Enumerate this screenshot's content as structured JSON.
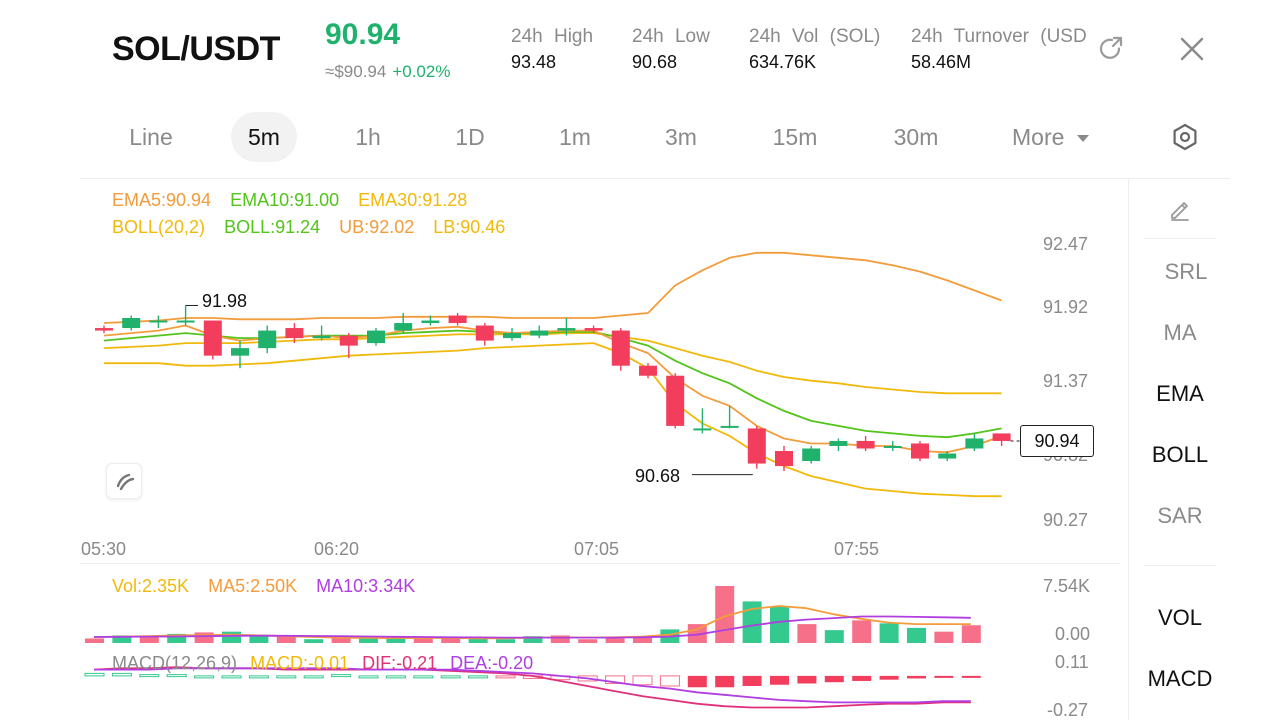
{
  "header": {
    "pair": "SOL/USDT",
    "price": "90.94",
    "approx": "≈$90.94",
    "change": "+0.02%",
    "stats": [
      {
        "label": "24h  High",
        "value": "93.48"
      },
      {
        "label": "24h  Low",
        "value": "90.68"
      },
      {
        "label": "24h  Vol (SOL)",
        "value": "634.76K"
      },
      {
        "label": "24h  Turnover (USD",
        "value": "58.46M"
      }
    ],
    "icons": [
      "share-icon",
      "close-icon"
    ]
  },
  "tabs": [
    {
      "label": "Line"
    },
    {
      "label": "5m",
      "active": true
    },
    {
      "label": "1h"
    },
    {
      "label": "1D"
    },
    {
      "label": "1m"
    },
    {
      "label": "3m"
    },
    {
      "label": "15m"
    },
    {
      "label": "30m"
    },
    {
      "label": "More"
    }
  ],
  "indicators": {
    "ema": {
      "ema5": "EMA5:90.94",
      "ema10": "EMA10:91.00",
      "ema30": "EMA30:91.28"
    },
    "boll": {
      "name": "BOLL(20,2)",
      "mid": "BOLL:91.24",
      "ub": "UB:92.02",
      "lb": "LB:90.46"
    },
    "vol": {
      "vol": "Vol:2.35K",
      "ma5": "MA5:2.50K",
      "ma10": "MA10:3.34K"
    },
    "macd": {
      "name": "MACD(12,26,9)",
      "macd": "MACD:-0.01",
      "dif": "DIF:-0.21",
      "dea": "DEA:-0.20"
    }
  },
  "side_panel": {
    "tools": [
      "SRL",
      "MA",
      "EMA",
      "BOLL",
      "SAR"
    ],
    "active": [
      "EMA",
      "BOLL"
    ],
    "sub": [
      "VOL",
      "MACD"
    ]
  },
  "colors": {
    "up": "#20b26c",
    "down": "#f23d5c",
    "ema5": "#f5a623",
    "ema10": "#52c41a",
    "ema30": "#f0b90b"
  },
  "chart_data": {
    "type": "candlestick",
    "x_ticks": [
      "05:30",
      "06:20",
      "07:05",
      "07:55"
    ],
    "y_ticks": [
      "92.47",
      "91.92",
      "91.37",
      "90.82",
      "90.27"
    ],
    "vol_ticks": [
      "7.54K",
      "0.00"
    ],
    "macd_ticks": [
      "0.11",
      "-0.27"
    ],
    "current_price": "90.94",
    "high_label": "91.98",
    "low_label": "90.68",
    "candles": [
      [
        91.8,
        91.78,
        91.82,
        91.76
      ],
      [
        91.8,
        91.88,
        91.9,
        91.78
      ],
      [
        91.86,
        91.86,
        91.9,
        91.8
      ],
      [
        91.86,
        91.86,
        91.98,
        91.82
      ],
      [
        91.86,
        91.58,
        91.86,
        91.55
      ],
      [
        91.58,
        91.64,
        91.7,
        91.48
      ],
      [
        91.64,
        91.78,
        91.82,
        91.6
      ],
      [
        91.8,
        91.72,
        91.84,
        91.68
      ],
      [
        91.72,
        91.74,
        91.82,
        91.7
      ],
      [
        91.74,
        91.66,
        91.76,
        91.56
      ],
      [
        91.68,
        91.78,
        91.8,
        91.66
      ],
      [
        91.78,
        91.84,
        91.92,
        91.76
      ],
      [
        91.84,
        91.86,
        91.9,
        91.82
      ],
      [
        91.9,
        91.84,
        91.92,
        91.82
      ],
      [
        91.82,
        91.7,
        91.84,
        91.66
      ],
      [
        91.72,
        91.76,
        91.8,
        91.7
      ],
      [
        91.74,
        91.78,
        91.82,
        91.72
      ],
      [
        91.78,
        91.8,
        91.88,
        91.74
      ],
      [
        91.8,
        91.78,
        91.82,
        91.76
      ],
      [
        91.78,
        91.5,
        91.8,
        91.46
      ],
      [
        91.5,
        91.42,
        91.52,
        91.4
      ],
      [
        91.42,
        91.02,
        91.44,
        91.0
      ],
      [
        91.0,
        91.0,
        91.16,
        90.96
      ],
      [
        91.02,
        91.02,
        91.18,
        91.0
      ],
      [
        91.0,
        90.72,
        91.02,
        90.68
      ],
      [
        90.82,
        90.7,
        90.86,
        90.66
      ],
      [
        90.74,
        90.84,
        90.86,
        90.72
      ],
      [
        90.86,
        90.9,
        90.92,
        90.82
      ],
      [
        90.9,
        90.84,
        90.94,
        90.82
      ],
      [
        90.86,
        90.86,
        90.9,
        90.82
      ],
      [
        90.88,
        90.76,
        90.9,
        90.74
      ],
      [
        90.76,
        90.8,
        90.82,
        90.74
      ],
      [
        90.84,
        90.92,
        90.96,
        90.82
      ],
      [
        90.96,
        90.9,
        90.96,
        90.86
      ]
    ],
    "ema5_series": [
      91.74,
      91.76,
      91.78,
      91.82,
      91.74,
      91.7,
      91.72,
      91.73,
      91.74,
      91.72,
      91.74,
      91.78,
      91.8,
      91.81,
      91.78,
      91.76,
      91.77,
      91.78,
      91.78,
      91.68,
      91.6,
      91.4,
      91.26,
      91.18,
      91.02,
      90.92,
      90.88,
      90.88,
      90.86,
      90.86,
      90.82,
      90.81,
      90.86,
      90.94
    ],
    "ema10_series": [
      91.7,
      91.72,
      91.74,
      91.76,
      91.74,
      91.72,
      91.72,
      91.73,
      91.74,
      91.74,
      91.74,
      91.76,
      91.77,
      91.78,
      91.77,
      91.76,
      91.76,
      91.77,
      91.77,
      91.72,
      91.66,
      91.54,
      91.44,
      91.36,
      91.24,
      91.14,
      91.06,
      91.02,
      90.98,
      90.96,
      90.94,
      90.93,
      90.96,
      91.0
    ],
    "ema30_series": [
      91.64,
      91.65,
      91.66,
      91.68,
      91.68,
      91.68,
      91.69,
      91.7,
      91.71,
      91.71,
      91.72,
      91.73,
      91.74,
      91.75,
      91.75,
      91.75,
      91.75,
      91.76,
      91.76,
      91.73,
      91.7,
      91.64,
      91.58,
      91.53,
      91.46,
      91.41,
      91.38,
      91.36,
      91.33,
      91.31,
      91.29,
      91.28,
      91.28,
      91.28
    ],
    "boll_ub": [
      91.84,
      91.85,
      91.86,
      91.88,
      91.88,
      91.87,
      91.87,
      91.87,
      91.88,
      91.88,
      91.88,
      91.89,
      91.89,
      91.89,
      91.89,
      91.88,
      91.88,
      91.88,
      91.88,
      91.9,
      91.92,
      92.14,
      92.26,
      92.36,
      92.4,
      92.4,
      92.38,
      92.36,
      92.34,
      92.3,
      92.25,
      92.18,
      92.1,
      92.02
    ],
    "boll_lb": [
      91.52,
      91.52,
      91.52,
      91.5,
      91.5,
      91.51,
      91.52,
      91.54,
      91.56,
      91.58,
      91.59,
      91.6,
      91.61,
      91.62,
      91.64,
      91.65,
      91.66,
      91.67,
      91.68,
      91.6,
      91.48,
      91.2,
      91.04,
      90.94,
      90.8,
      90.7,
      90.62,
      90.57,
      90.52,
      90.5,
      90.48,
      90.47,
      90.46,
      90.46
    ],
    "volume": [
      0.6,
      1.0,
      0.8,
      1.2,
      1.4,
      1.5,
      1.1,
      1.0,
      0.5,
      0.8,
      0.6,
      0.7,
      0.6,
      0.7,
      0.6,
      0.5,
      0.9,
      1.0,
      0.5,
      0.6,
      0.8,
      1.8,
      2.5,
      7.54,
      5.5,
      4.8,
      2.5,
      1.7,
      3.0,
      2.6,
      2.0,
      1.5,
      2.35
    ],
    "volume_dir": [
      "d",
      "u",
      "d",
      "u",
      "d",
      "u",
      "u",
      "d",
      "u",
      "d",
      "u",
      "u",
      "d",
      "d",
      "u",
      "u",
      "u",
      "d",
      "d",
      "d",
      "d",
      "u",
      "d",
      "d",
      "u",
      "u",
      "d",
      "u",
      "d",
      "u",
      "u",
      "d"
    ],
    "vol_ma5": [
      0.8,
      0.85,
      0.9,
      1.0,
      1.05,
      1.1,
      1.0,
      0.9,
      0.8,
      0.7,
      0.68,
      0.65,
      0.66,
      0.66,
      0.62,
      0.62,
      0.7,
      0.75,
      0.72,
      0.75,
      0.85,
      1.1,
      1.8,
      3.5,
      4.5,
      4.9,
      4.6,
      3.8,
      3.2,
      2.7,
      2.5,
      2.5,
      2.5
    ],
    "vol_ma10": [
      0.8,
      0.82,
      0.84,
      0.86,
      0.9,
      0.95,
      0.96,
      0.95,
      0.93,
      0.9,
      0.86,
      0.82,
      0.8,
      0.76,
      0.74,
      0.72,
      0.72,
      0.72,
      0.72,
      0.72,
      0.75,
      0.85,
      1.1,
      1.7,
      2.3,
      2.8,
      3.1,
      3.3,
      3.5,
      3.5,
      3.45,
      3.4,
      3.34
    ],
    "macd_hist": [
      0.02,
      0.02,
      0.01,
      0.01,
      0.0,
      0.0,
      0.0,
      0.0,
      0.0,
      0.01,
      0.0,
      0.0,
      0.0,
      0.0,
      0.0,
      -0.01,
      -0.02,
      -0.03,
      -0.04,
      -0.06,
      -0.07,
      -0.08,
      -0.09,
      -0.09,
      -0.08,
      -0.07,
      -0.06,
      -0.05,
      -0.04,
      -0.03,
      -0.02,
      -0.01,
      -0.01
    ],
    "macd_dif": [
      0.05,
      0.06,
      0.06,
      0.07,
      0.06,
      0.06,
      0.06,
      0.05,
      0.05,
      0.05,
      0.05,
      0.05,
      0.05,
      0.04,
      0.03,
      0.02,
      0.0,
      -0.04,
      -0.08,
      -0.12,
      -0.16,
      -0.19,
      -0.22,
      -0.24,
      -0.25,
      -0.25,
      -0.25,
      -0.24,
      -0.23,
      -0.22,
      -0.22,
      -0.21,
      -0.21
    ],
    "macd_dea": [
      0.05,
      0.05,
      0.05,
      0.06,
      0.06,
      0.06,
      0.06,
      0.06,
      0.06,
      0.06,
      0.05,
      0.05,
      0.05,
      0.05,
      0.04,
      0.03,
      0.02,
      0.0,
      -0.02,
      -0.05,
      -0.08,
      -0.1,
      -0.13,
      -0.15,
      -0.17,
      -0.19,
      -0.2,
      -0.21,
      -0.21,
      -0.21,
      -0.21,
      -0.2,
      -0.2
    ]
  }
}
